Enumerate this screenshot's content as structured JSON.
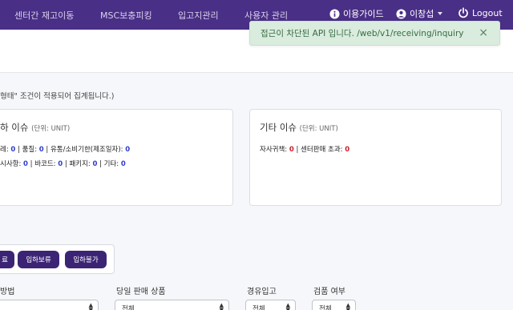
{
  "navbar": {
    "items": [
      "센터간 재고이동",
      "MSC보충피킹",
      "입고지관리",
      "사용자 관리"
    ],
    "guide_label": "이용가이드",
    "user_label": "이창섭",
    "logout_label": "Logout"
  },
  "toast": {
    "message": "접근이 차단된 API 입니다. /web/v1/receiving/inquiry",
    "close": "×"
  },
  "note": "형태\" 조건이 적용되어 집계됩니다.)",
  "cards": {
    "left": {
      "title": "하 이슈",
      "unit": "(단위: UNIT)",
      "line1": {
        "l1": "레: ",
        "v1": "0",
        "l2": " | 품질: ",
        "v2": "0",
        "l3": " | 유통/소비기한(제조일자): ",
        "v3": "0"
      },
      "line2": {
        "l1": "시사항: ",
        "v1": "0",
        "l2": " | 바코드: ",
        "v2": "0",
        "l3": " | 패키지: ",
        "v3": "0",
        "l4": " | 기타: ",
        "v4": "0"
      }
    },
    "right": {
      "title": "기타 이슈",
      "unit": "(단위: UNIT)",
      "l1": "자사귀책: ",
      "v1": "0",
      "l2": " | 센터판매 초과: ",
      "v2": "0"
    }
  },
  "buttons": [
    "료",
    "입하보류",
    "입하불가"
  ],
  "filters": {
    "labels": [
      "방법",
      "당일 판매 상품",
      "경유입고",
      "검품 여부"
    ],
    "values": [
      "",
      "전체",
      "전체",
      "전체"
    ]
  },
  "colors": {
    "navbar": "#4a2f86",
    "toast_bg": "#d9ecdd",
    "count_blue": "#2f3bd0",
    "count_red": "#d01c2a",
    "button": "#3c2475"
  }
}
